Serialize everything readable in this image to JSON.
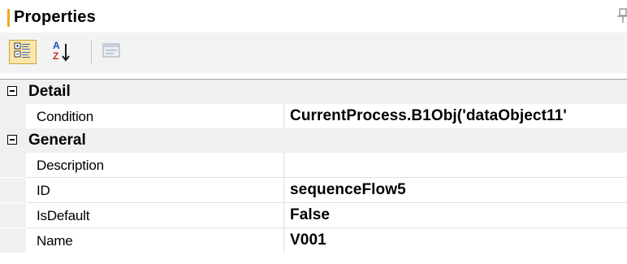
{
  "window": {
    "title": "Properties",
    "accent_color": "#f5a623"
  },
  "toolbar": {
    "buttons": [
      {
        "name": "categorized-view",
        "icon": "categorized-icon",
        "active": true
      },
      {
        "name": "alphabetical-sort",
        "icon": "sort-az-icon",
        "active": false
      },
      {
        "name": "property-pages",
        "icon": "property-pages-icon",
        "active": false
      }
    ],
    "sort_letter_top": "A",
    "sort_letter_bottom": "Z"
  },
  "grid": {
    "categories": [
      {
        "label": "Detail",
        "expanded": true,
        "properties": [
          {
            "name": "Condition",
            "value": "CurrentProcess.B1Obj('dataObject11'"
          }
        ]
      },
      {
        "label": "General",
        "expanded": true,
        "properties": [
          {
            "name": "Description",
            "value": ""
          },
          {
            "name": "ID",
            "value": "sequenceFlow5"
          },
          {
            "name": "IsDefault",
            "value": "False"
          },
          {
            "name": "Name",
            "value": "V001"
          }
        ]
      }
    ]
  }
}
